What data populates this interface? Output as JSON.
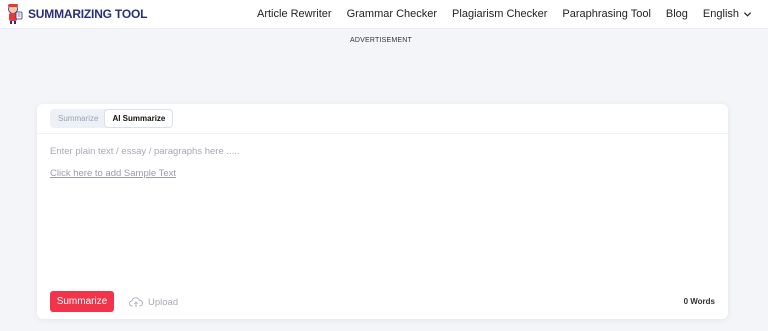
{
  "header": {
    "logo_text": "SUMMARIZING TOOL",
    "nav": [
      {
        "label": "Article Rewriter"
      },
      {
        "label": "Grammar Checker"
      },
      {
        "label": "Plagiarism Checker"
      },
      {
        "label": "Paraphrasing Tool"
      },
      {
        "label": "Blog"
      }
    ],
    "language": "English",
    "language_icon": "chevron-down-icon"
  },
  "advertisement_label": "ADVERTISEMENT",
  "tool": {
    "tabs": [
      {
        "label": "Summarize",
        "active": false
      },
      {
        "label": "AI Summarize",
        "active": true
      }
    ],
    "editor_placeholder": "Enter plain text / essay / paragraphs here .....",
    "sample_link": "Click here to add Sample Text",
    "summarize_button": "Summarize",
    "upload_label": "Upload",
    "upload_icon": "cloud-upload-icon",
    "word_count": "0",
    "word_count_unit": "Words"
  },
  "colors": {
    "brand": "#2a2f7a",
    "accent": "#f2344b",
    "background": "#f4f5f8"
  }
}
